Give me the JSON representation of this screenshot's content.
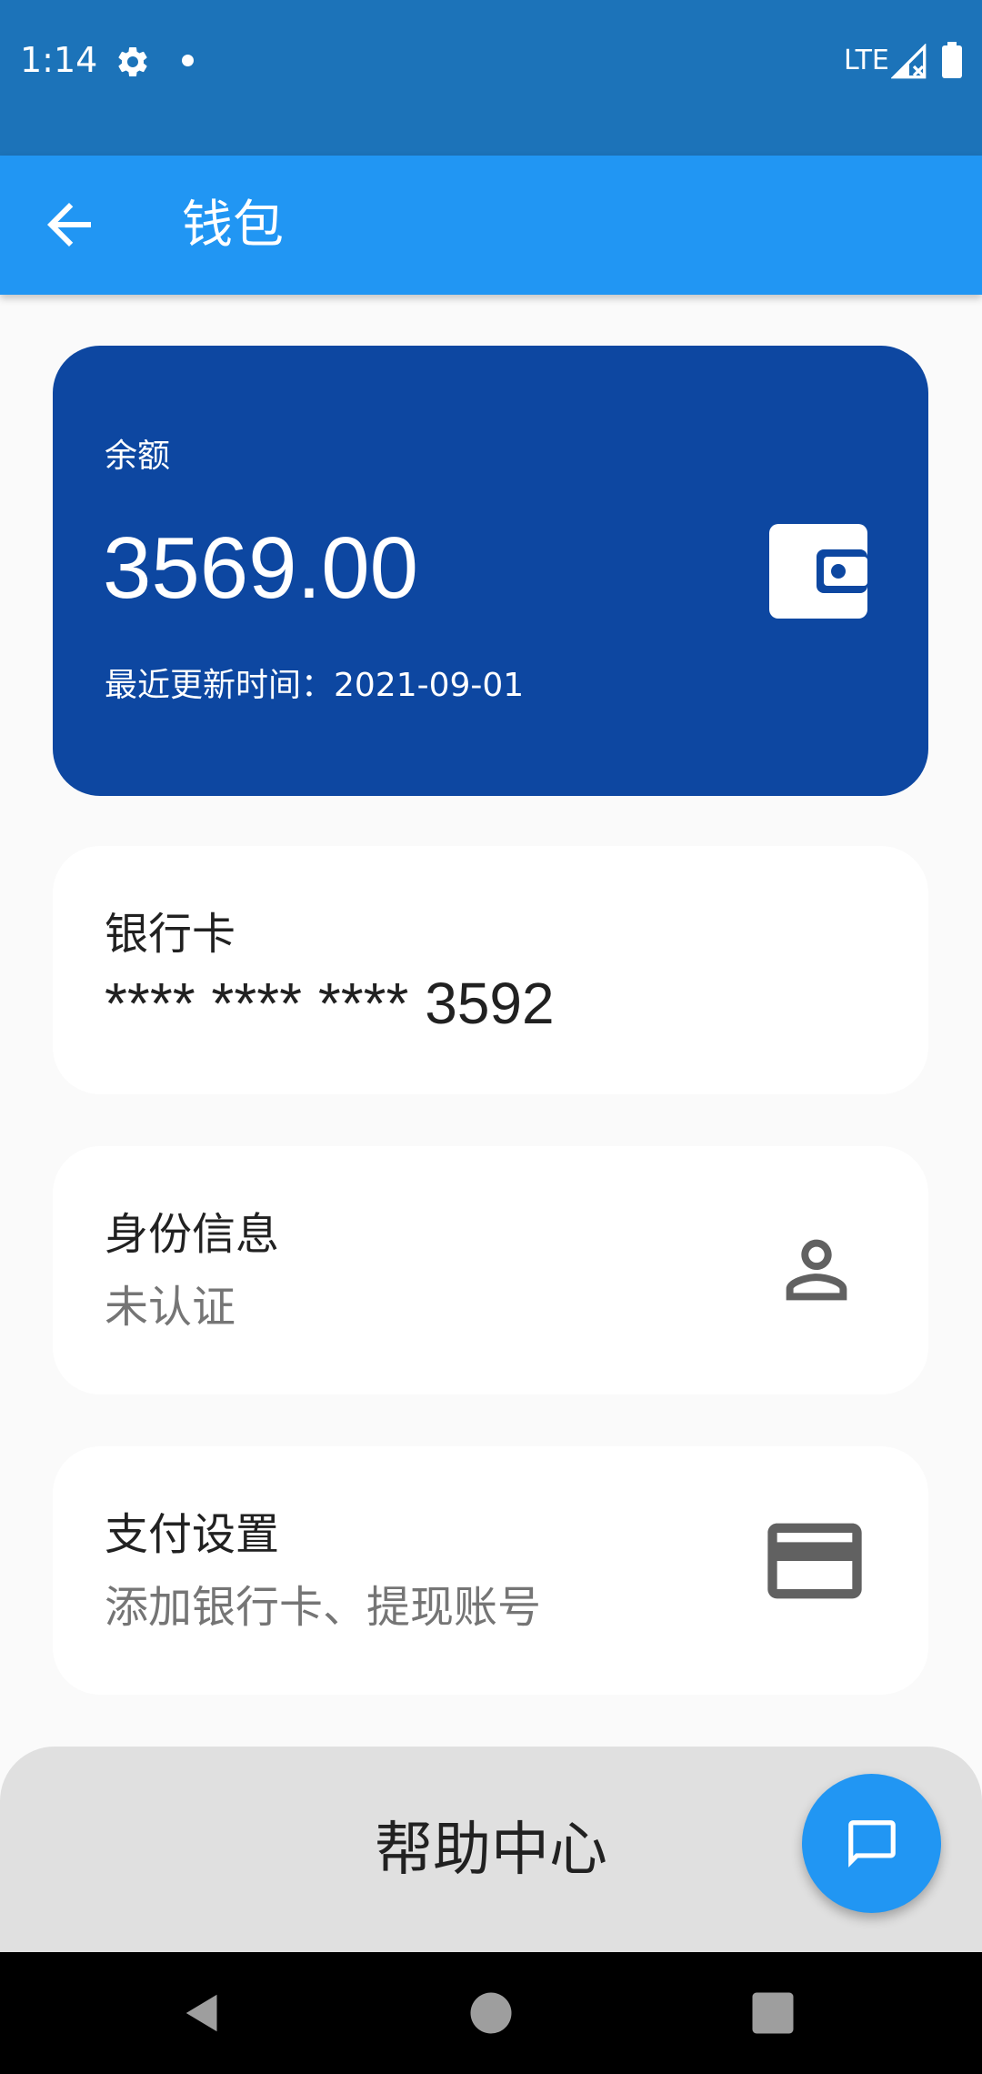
{
  "status_bar": {
    "time": "1:14",
    "network": "LTE",
    "icons": [
      "settings-icon",
      "notification-dot",
      "signal-icon",
      "battery-icon"
    ]
  },
  "app_bar": {
    "title": "钱包",
    "back_icon": "arrow-back-icon"
  },
  "balance_card": {
    "label": "余额",
    "amount": "3569.00",
    "updated": "最近更新时间：2021-09-01",
    "icon": "wallet-icon"
  },
  "bank_card": {
    "title": "银行卡",
    "number": "**** **** **** 3592"
  },
  "identity_card": {
    "title": "身份信息",
    "status": "未认证",
    "icon": "person-icon"
  },
  "payment_card": {
    "title": "支付设置",
    "subtitle": "添加银行卡、提现账号",
    "icon": "credit-card-icon"
  },
  "help": {
    "label": "帮助中心",
    "fab_icon": "chat-icon"
  },
  "nav_bar": {
    "icons": [
      "nav-back-icon",
      "nav-home-icon",
      "nav-recents-icon"
    ]
  },
  "colors": {
    "status_bar": "#1c73b9",
    "app_bar": "#2196f3",
    "balance_card": "#0d47a1",
    "background": "#fafafa",
    "icon_gray": "#616161",
    "help_bar": "#e0e0e0"
  }
}
